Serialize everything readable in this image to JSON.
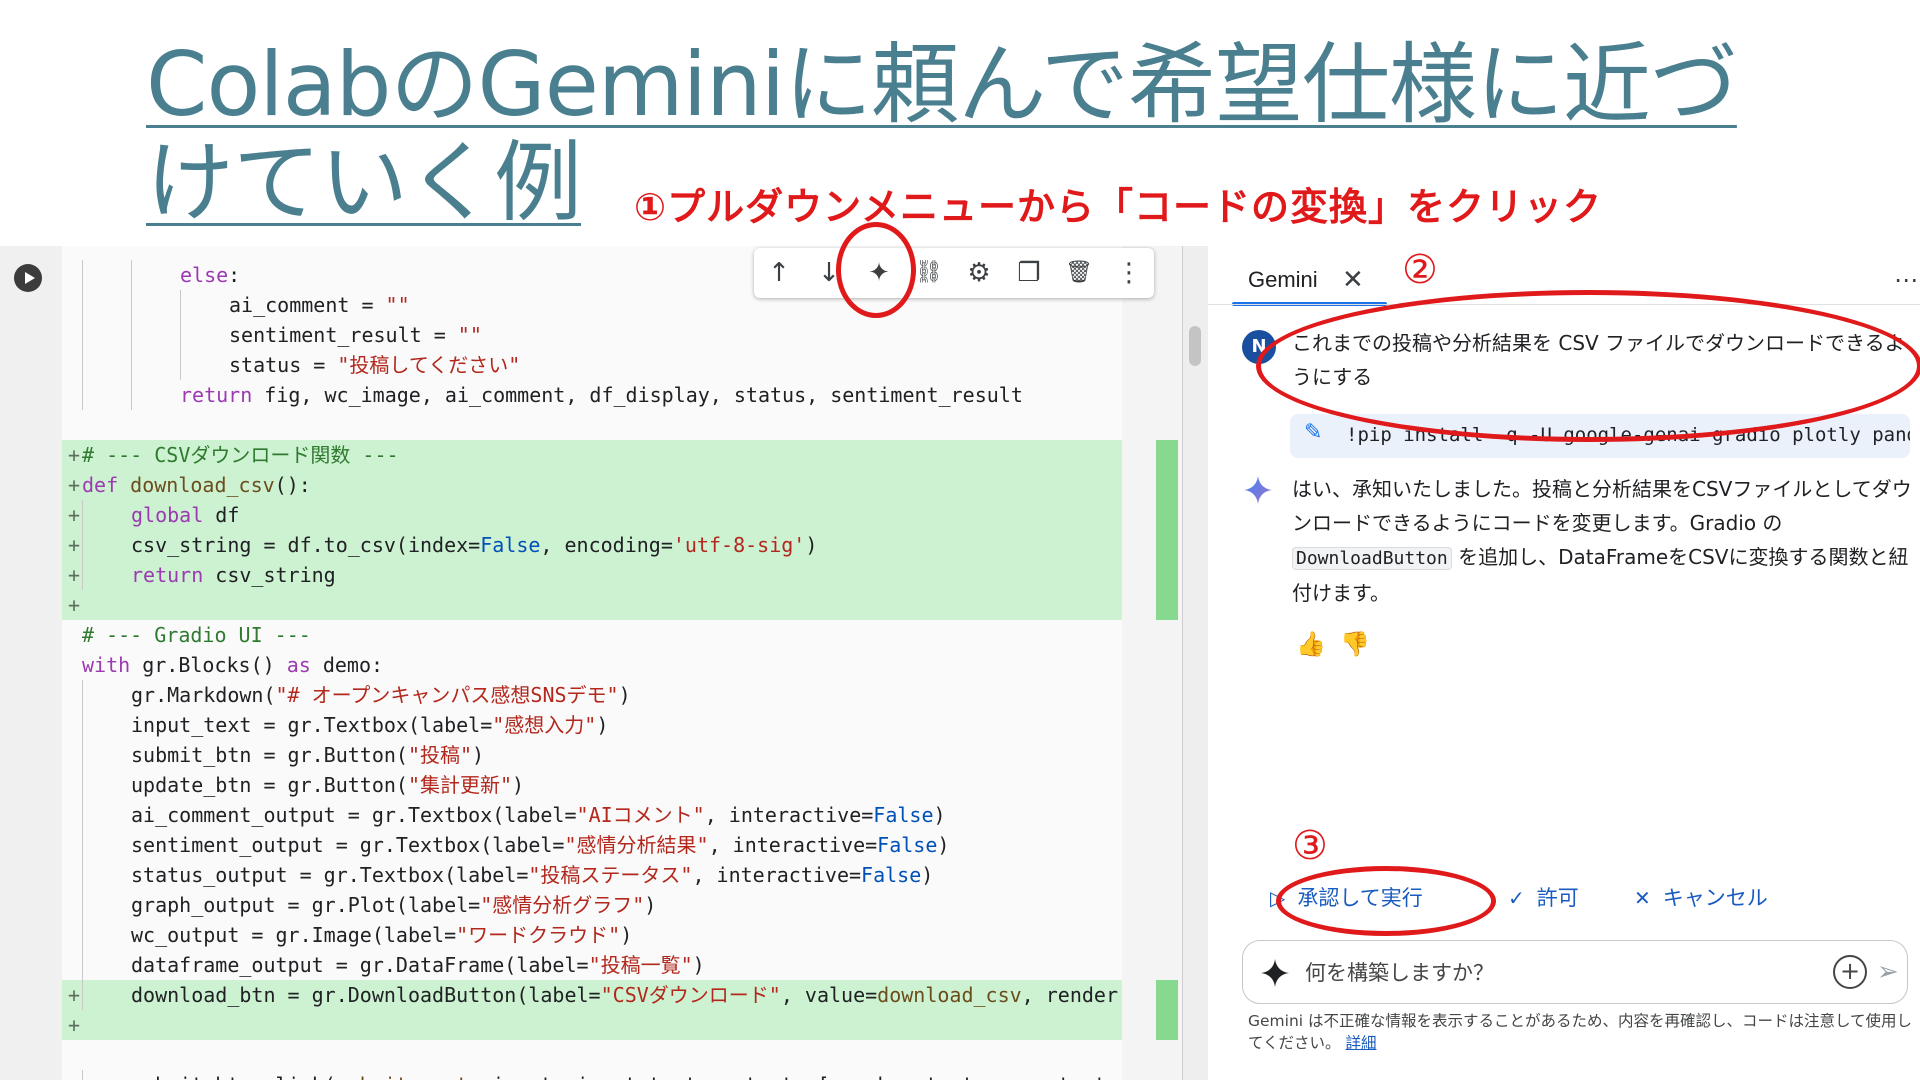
{
  "slide": {
    "title": "ColabのGeminiに頼んで希望仕様に近づけていく例",
    "step1_label": "①プルダウンメニューから「コードの変換」をクリック",
    "step2_label": "②",
    "step3_label": "③"
  },
  "toolbar": {
    "icons": [
      {
        "name": "move-up-icon",
        "glyph": "↑"
      },
      {
        "name": "move-down-icon",
        "glyph": "↓"
      },
      {
        "name": "gemini-sparkle-icon",
        "glyph": "✦"
      },
      {
        "name": "link-icon",
        "glyph": "⛓"
      },
      {
        "name": "gear-icon",
        "glyph": "⚙"
      },
      {
        "name": "mirror-cell-icon",
        "glyph": "❐"
      },
      {
        "name": "trash-icon",
        "glyph": "🗑"
      },
      {
        "name": "more-vert-icon",
        "glyph": "⋮"
      }
    ]
  },
  "code": {
    "lines": [
      {
        "added": false,
        "indent": 2,
        "text": "else:"
      },
      {
        "added": false,
        "indent": 3,
        "text": "ai_comment = \"\""
      },
      {
        "added": false,
        "indent": 3,
        "text": "sentiment_result = \"\""
      },
      {
        "added": false,
        "indent": 3,
        "text": "status = \"投稿してください\""
      },
      {
        "added": false,
        "indent": 2,
        "text": "return fig, wc_image, ai_comment, df_display, status, sentiment_result"
      },
      {
        "added": false,
        "indent": 0,
        "text": ""
      },
      {
        "added": true,
        "indent": 0,
        "text": "# --- CSVダウンロード関数 ---"
      },
      {
        "added": true,
        "indent": 0,
        "text": "def download_csv():"
      },
      {
        "added": true,
        "indent": 1,
        "text": "global df"
      },
      {
        "added": true,
        "indent": 1,
        "text": "csv_string = df.to_csv(index=False, encoding='utf-8-sig')"
      },
      {
        "added": true,
        "indent": 1,
        "text": "return csv_string"
      },
      {
        "added": true,
        "indent": 0,
        "text": ""
      },
      {
        "added": false,
        "indent": 0,
        "text": "# --- Gradio UI ---"
      },
      {
        "added": false,
        "indent": 0,
        "text": "with gr.Blocks() as demo:"
      },
      {
        "added": false,
        "indent": 1,
        "text": "gr.Markdown(\"# オープンキャンパス感想SNSデモ\")"
      },
      {
        "added": false,
        "indent": 1,
        "text": "input_text = gr.Textbox(label=\"感想入力\")"
      },
      {
        "added": false,
        "indent": 1,
        "text": "submit_btn = gr.Button(\"投稿\")"
      },
      {
        "added": false,
        "indent": 1,
        "text": "update_btn = gr.Button(\"集計更新\")"
      },
      {
        "added": false,
        "indent": 1,
        "text": "ai_comment_output = gr.Textbox(label=\"AIコメント\", interactive=False)"
      },
      {
        "added": false,
        "indent": 1,
        "text": "sentiment_output = gr.Textbox(label=\"感情分析結果\", interactive=False)"
      },
      {
        "added": false,
        "indent": 1,
        "text": "status_output = gr.Textbox(label=\"投稿ステータス\", interactive=False)"
      },
      {
        "added": false,
        "indent": 1,
        "text": "graph_output = gr.Plot(label=\"感情分析グラフ\")"
      },
      {
        "added": false,
        "indent": 1,
        "text": "wc_output = gr.Image(label=\"ワードクラウド\")"
      },
      {
        "added": false,
        "indent": 1,
        "text": "dataframe_output = gr.DataFrame(label=\"投稿一覧\")"
      },
      {
        "added": true,
        "indent": 1,
        "text": "download_btn = gr.DownloadButton(label=\"CSVダウンロード\", value=download_csv, render"
      },
      {
        "added": true,
        "indent": 0,
        "text": ""
      },
      {
        "added": false,
        "indent": 0,
        "text": ""
      },
      {
        "added": false,
        "indent": 1,
        "text": "submit_btn.click(submit_post, inputs=input_text, outputs=[graph_output, wc_output,"
      }
    ]
  },
  "gemini": {
    "tab_label": "Gemini",
    "avatar_initial": "N",
    "user_prompt": "これまでの投稿や分析結果を CSV ファイルでダウンロードできるようにする",
    "code_chip": "!pip install -q -U google-genai gradio plotly pand…",
    "response_part1": "はい、承知いたしました。投稿と分析結果をCSVファイルとしてダウンロードできるようにコードを変更します。Gradio の ",
    "response_code": "DownloadButton",
    "response_part2": " を追加し、DataFrameをCSVに変換する関数と紐付けます。",
    "actions": {
      "approve": "承認して実行",
      "allow": "許可",
      "cancel": "キャンセル"
    },
    "input_placeholder": "何を構築しますか？",
    "disclaimer": "Gemini は不正確な情報を表示することがあるため、内容を再確認し、コードは注意して使用してください。",
    "disclaimer_link": "詳細"
  },
  "colors": {
    "accent_red": "#e0191b",
    "title_teal": "#4a7f8f",
    "link_blue": "#1a5bbf",
    "diff_green": "#ccf2d1"
  }
}
